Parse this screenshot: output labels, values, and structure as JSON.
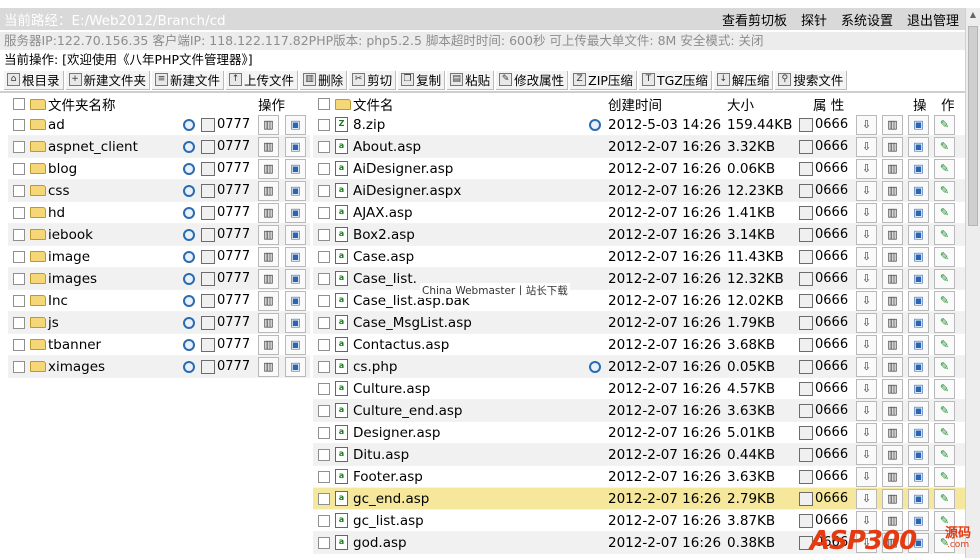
{
  "path_bar": {
    "label": "当前路经：",
    "value": "E:/Web2012/Branch/cd"
  },
  "top_menu": [
    "查看剪切板",
    "探针",
    "系统设置",
    "退出管理"
  ],
  "server_info": "服务器IP:122.70.156.35 客户端IP: 118.122.117.82PHP版本: php5.2.5 脚本超时时间: 600秒 可上传最大单文件: 8M 安全模式: 关闭",
  "current_op": "当前操作: [欢迎使用《八年PHP文件管理器》]",
  "toolbar": [
    "根目录",
    "新建文件夹",
    "新建文件",
    "上传文件",
    "删除",
    "剪切",
    "复制",
    "粘贴",
    "修改属性",
    "ZIP压缩",
    "TGZ压缩",
    "解压缩",
    "搜索文件"
  ],
  "left_header": {
    "name": "文件夹名称",
    "ops": "操作"
  },
  "folders": [
    {
      "name": "ad",
      "perm": "0777"
    },
    {
      "name": "aspnet_client",
      "perm": "0777"
    },
    {
      "name": "blog",
      "perm": "0777"
    },
    {
      "name": "css",
      "perm": "0777"
    },
    {
      "name": "hd",
      "perm": "0777"
    },
    {
      "name": "iebook",
      "perm": "0777"
    },
    {
      "name": "image",
      "perm": "0777"
    },
    {
      "name": "images",
      "perm": "0777"
    },
    {
      "name": "Inc",
      "perm": "0777"
    },
    {
      "name": "js",
      "perm": "0777"
    },
    {
      "name": "tbanner",
      "perm": "0777"
    },
    {
      "name": "ximages",
      "perm": "0777"
    }
  ],
  "right_header": {
    "name": "文件名",
    "created": "创建时间",
    "size": "大小",
    "attr": "属 性",
    "ops1": "操",
    "ops2": "作"
  },
  "files": [
    {
      "name": "8.zip",
      "date": "2012-5-03 14:26",
      "size": "159.44KB",
      "perm": "0666",
      "mag": true
    },
    {
      "name": "About.asp",
      "date": "2012-2-07 16:26",
      "size": "3.32KB",
      "perm": "0666"
    },
    {
      "name": "AiDesigner.asp",
      "date": "2012-2-07 16:26",
      "size": "0.06KB",
      "perm": "0666"
    },
    {
      "name": "AiDesigner.aspx",
      "date": "2012-2-07 16:26",
      "size": "12.23KB",
      "perm": "0666"
    },
    {
      "name": "AJAX.asp",
      "date": "2012-2-07 16:26",
      "size": "1.41KB",
      "perm": "0666"
    },
    {
      "name": "Box2.asp",
      "date": "2012-2-07 16:26",
      "size": "3.14KB",
      "perm": "0666"
    },
    {
      "name": "Case.asp",
      "date": "2012-2-07 16:26",
      "size": "11.43KB",
      "perm": "0666"
    },
    {
      "name": "Case_list.",
      "date": "2012-2-07 16:26",
      "size": "12.32KB",
      "perm": "0666"
    },
    {
      "name": "Case_list.asp.bak",
      "date": "2012-2-07 16:26",
      "size": "12.02KB",
      "perm": "0666"
    },
    {
      "name": "Case_MsgList.asp",
      "date": "2012-2-07 16:26",
      "size": "1.79KB",
      "perm": "0666"
    },
    {
      "name": "Contactus.asp",
      "date": "2012-2-07 16:26",
      "size": "3.68KB",
      "perm": "0666"
    },
    {
      "name": "cs.php",
      "date": "2012-2-07 16:26",
      "size": "0.05KB",
      "perm": "0666",
      "mag": true
    },
    {
      "name": "Culture.asp",
      "date": "2012-2-07 16:26",
      "size": "4.57KB",
      "perm": "0666"
    },
    {
      "name": "Culture_end.asp",
      "date": "2012-2-07 16:26",
      "size": "3.63KB",
      "perm": "0666"
    },
    {
      "name": "Designer.asp",
      "date": "2012-2-07 16:26",
      "size": "5.01KB",
      "perm": "0666"
    },
    {
      "name": "Ditu.asp",
      "date": "2012-2-07 16:26",
      "size": "0.44KB",
      "perm": "0666"
    },
    {
      "name": "Footer.asp",
      "date": "2012-2-07 16:26",
      "size": "3.63KB",
      "perm": "0666"
    },
    {
      "name": "gc_end.asp",
      "date": "2012-2-07 16:26",
      "size": "2.79KB",
      "perm": "0666",
      "highlight": true
    },
    {
      "name": "gc_list.asp",
      "date": "2012-2-07 16:26",
      "size": "3.87KB",
      "perm": "0666"
    },
    {
      "name": "god.asp",
      "date": "2012-2-07 16:26",
      "size": "0.38KB",
      "perm": "0666"
    }
  ],
  "watermark": "China Webmaster丨站长下载",
  "logo": {
    "main": "ASP300",
    "side": "源码",
    "sub": ".com"
  }
}
